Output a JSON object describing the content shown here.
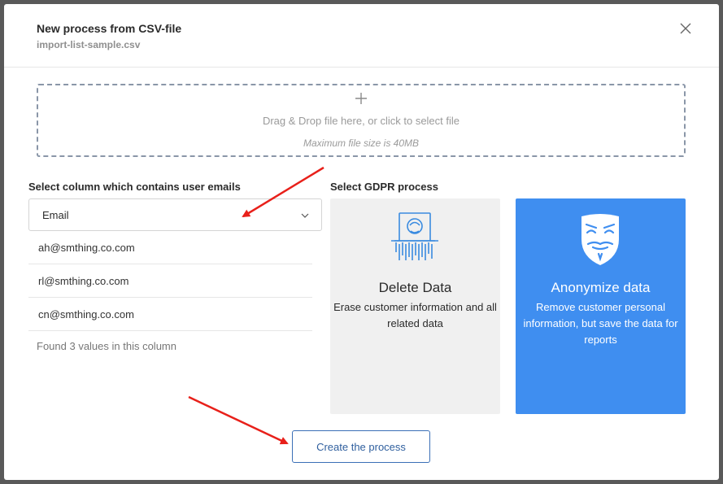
{
  "dialog": {
    "title": "New process from CSV-file",
    "filename": "import-list-sample.csv",
    "close_icon": "close-icon"
  },
  "dropzone": {
    "icon": "plus-icon",
    "text": "Drag & Drop file here, or click to select file",
    "note": "Maximum file size is 40MB"
  },
  "email_column": {
    "label": "Select column which contains user emails",
    "selected": "Email",
    "chevron_icon": "chevron-down-icon",
    "values": [
      "ah@smthing.co.com",
      "rl@smthing.co.com",
      "cn@smthing.co.com"
    ],
    "found_text": "Found 3 values in this column"
  },
  "gdpr": {
    "label": "Select GDPR process",
    "options": [
      {
        "title": "Delete Data",
        "description": "Erase customer information and all related data",
        "icon": "shredder-icon",
        "selected": false
      },
      {
        "title": "Anonymize data",
        "description": "Remove customer personal information, but save the data for reports",
        "icon": "anonymous-mask-icon",
        "selected": true
      }
    ]
  },
  "actions": {
    "create_label": "Create the process"
  },
  "colors": {
    "accent": "#3f8ef0",
    "button_border": "#3b6fb6",
    "annotation_arrow": "#e8201a",
    "overlay": "#595959"
  }
}
